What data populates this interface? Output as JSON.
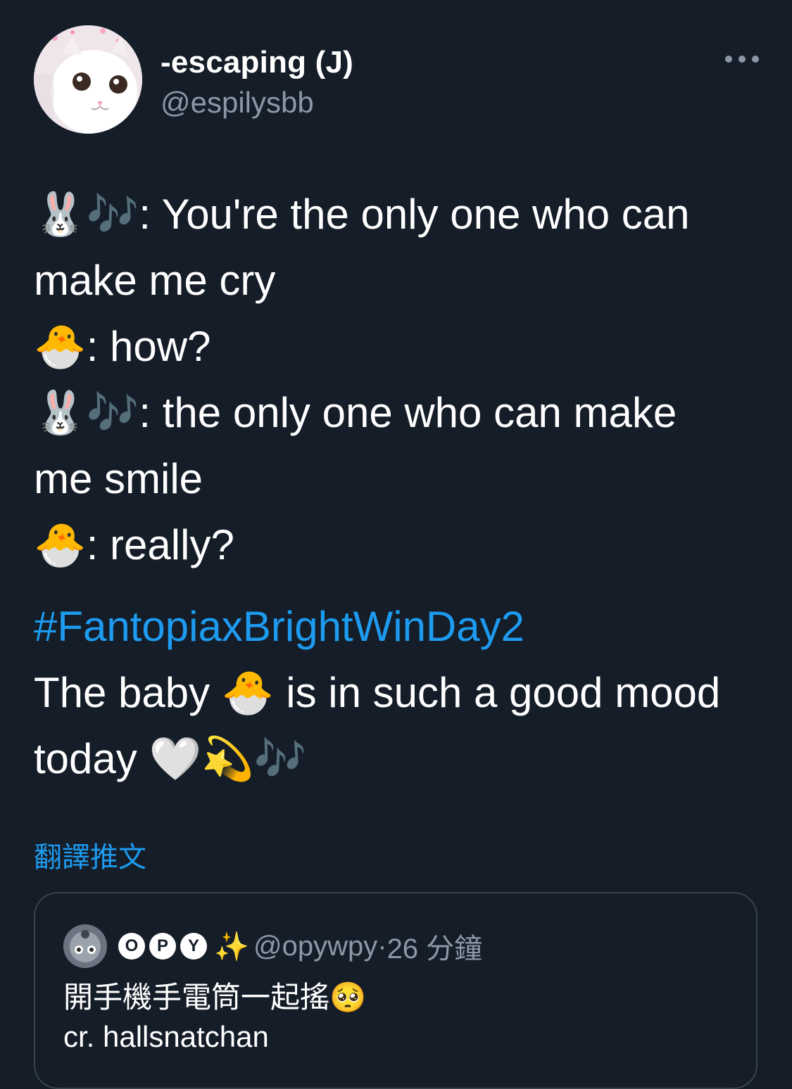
{
  "tweet": {
    "author": {
      "display_name": "-escaping (J)",
      "handle": "@espilysbb",
      "avatar": "cat-avatar"
    },
    "more_icon": "more-horizontal-icon",
    "lines": [
      {
        "emoji": "🐰🎶",
        "text": ": You're the only one who can"
      },
      {
        "emoji": "",
        "text": "make me cry"
      },
      {
        "emoji": "🐣",
        "text": ": how?"
      },
      {
        "emoji": "🐰🎶",
        "text": ": the only one who can make"
      },
      {
        "emoji": "",
        "text": "me smile"
      },
      {
        "emoji": "🐣",
        "text": ": really?"
      }
    ],
    "hashtag": "#FantopiaxBrightWinDay2",
    "closing": {
      "part1": "The baby ",
      "emoji1": "🐣",
      "part2": " is in such a good mood",
      "part3": "today ",
      "emoji2": "🤍💫🎶"
    },
    "translate_label": "翻譯推文"
  },
  "quote": {
    "badges": [
      "O",
      "P",
      "Y"
    ],
    "sparkle": "✨",
    "handle": "@opywpy",
    "separator": " · ",
    "time": "26 分鐘",
    "text_line1": "開手機手電筒一起搖",
    "text_line1_emoji": "🥺",
    "text_line2": "cr. hallsnatchan"
  },
  "colors": {
    "background": "#151d28",
    "text": "#ffffff",
    "secondary": "#8b98a5",
    "link": "#1d9bf0",
    "border": "#38444d"
  }
}
